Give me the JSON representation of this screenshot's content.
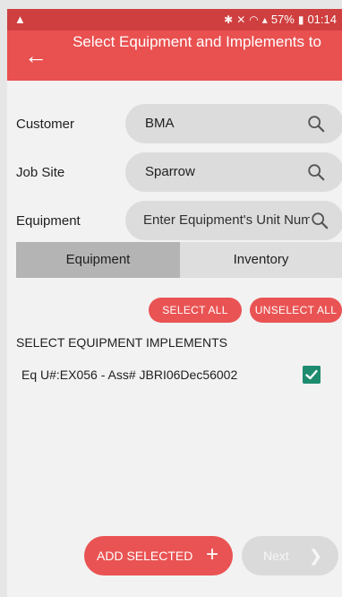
{
  "status_bar": {
    "warning_icon": "warning-icon",
    "battery": "57%",
    "time": "01:14"
  },
  "app_bar": {
    "title": "Select Equipment and Implements to"
  },
  "form": {
    "customer_label": "Customer",
    "customer_value": "BMA",
    "jobsite_label": "Job Site",
    "jobsite_value": "Sparrow",
    "equipment_label": "Equipment",
    "equipment_placeholder": "Enter Equipment's Unit Number"
  },
  "tabs": [
    {
      "label": "Equipment",
      "active": true
    },
    {
      "label": "Inventory",
      "active": false
    }
  ],
  "actions": {
    "select_all": "SELECT ALL",
    "unselect_all": "UNSELECT ALL"
  },
  "section_title": "SELECT EQUIPMENT IMPLEMENTS",
  "items": [
    {
      "text": "Eq U#:EX056 - Ass# JBRI06Dec56002",
      "checked": true
    }
  ],
  "footer": {
    "add_selected": "ADD SELECTED",
    "next": "Next"
  },
  "colors": {
    "accent": "#ea5353",
    "status_bar": "#cf3f3f",
    "checkbox": "#1e8b6f"
  }
}
